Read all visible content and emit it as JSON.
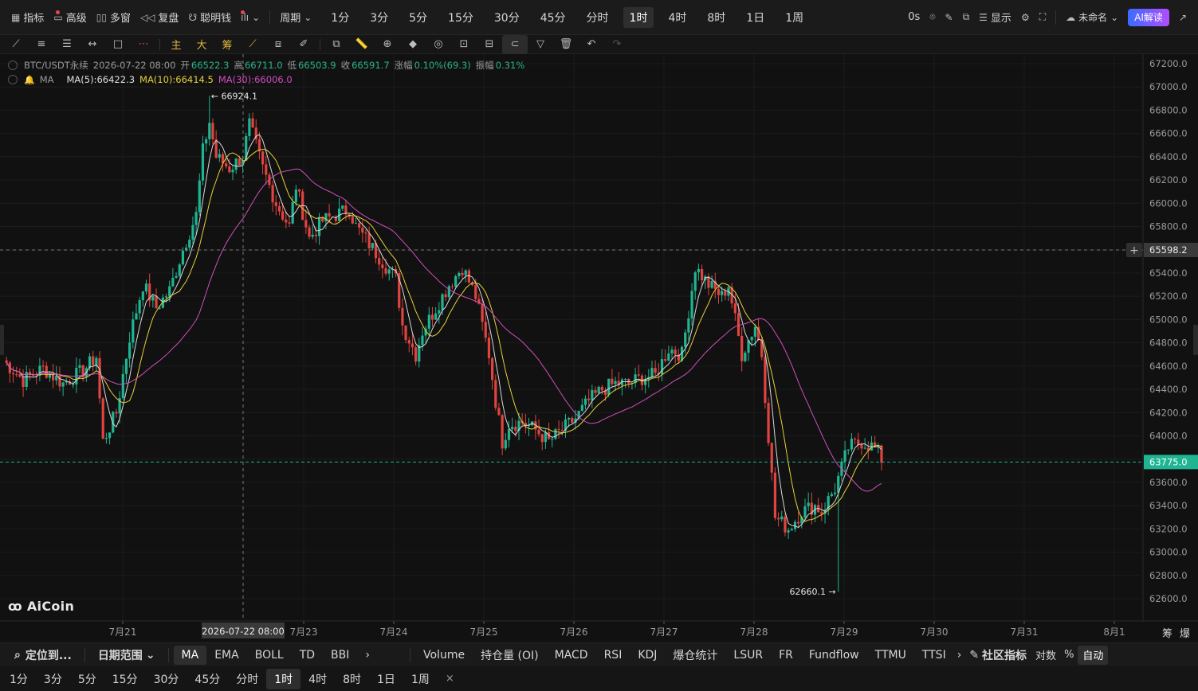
{
  "topbar": {
    "indicators": "指标",
    "advanced": "高级",
    "multi_window": "多窗",
    "replay": "复盘",
    "smart_money": "聪明钱",
    "period_dropdown": "周期",
    "periods": [
      "1分",
      "3分",
      "5分",
      "15分",
      "30分",
      "45分",
      "分时",
      "1时",
      "4时",
      "8时",
      "1日",
      "1周"
    ],
    "active_period": "1时",
    "countdown": "0s",
    "display": "显示",
    "layout_name": "未命名",
    "ai_button": "AI解读"
  },
  "drawbar": {
    "main": "主",
    "big": "大",
    "chip": "筹"
  },
  "legend": {
    "symbol": "BTC/USDT永续",
    "datetime": "2026-07-22 08:00",
    "open_label": "开",
    "open": "66522.3",
    "high_label": "高",
    "high": "66711.0",
    "low_label": "低",
    "low": "66503.9",
    "close_label": "收",
    "close": "66591.7",
    "change_label": "涨幅",
    "change": "0.10%(69.3)",
    "amp_label": "振幅",
    "amp": "0.31%",
    "ma_name": "MA",
    "ma5": "MA(5):66422.3",
    "ma10": "MA(10):66414.5",
    "ma30": "MA(30):66006.0"
  },
  "chart_data": {
    "type": "candlestick",
    "symbol": "BTC/USDT永续",
    "interval": "1时",
    "y_ticks": [
      "67200.0",
      "67000.0",
      "66800.0",
      "66600.0",
      "66400.0",
      "66200.0",
      "66000.0",
      "65800.0",
      "65600.0",
      "65400.0",
      "65200.0",
      "65000.0",
      "64800.0",
      "64600.0",
      "64400.0",
      "64200.0",
      "64000.0",
      "63800.0",
      "63600.0",
      "63400.0",
      "63200.0",
      "63000.0",
      "62800.0",
      "62600.0"
    ],
    "ylim": [
      62450,
      67300
    ],
    "x_ticks": [
      "7月21",
      "7月23",
      "7月24",
      "7月25",
      "7月26",
      "7月27",
      "7月28",
      "7月29",
      "7月30",
      "7月31",
      "8月1"
    ],
    "crosshair_x_label": "2026-07-22 08:00",
    "crosshair_price": "65598.2",
    "last_price": "63775.0",
    "high_marker": "66924.1",
    "low_marker": "62660.1",
    "close_path": [
      [
        0,
        64650
      ],
      [
        6,
        64480
      ],
      [
        12,
        64580
      ],
      [
        18,
        64450
      ],
      [
        24,
        64560
      ],
      [
        28,
        64680
      ],
      [
        30,
        63950
      ],
      [
        34,
        64200
      ],
      [
        38,
        64850
      ],
      [
        42,
        65300
      ],
      [
        46,
        65100
      ],
      [
        50,
        65250
      ],
      [
        54,
        65600
      ],
      [
        58,
        65900
      ],
      [
        60,
        66450
      ],
      [
        62,
        66700
      ],
      [
        64,
        66400
      ],
      [
        68,
        66300
      ],
      [
        72,
        66400
      ],
      [
        74,
        66680
      ],
      [
        78,
        66300
      ],
      [
        82,
        66000
      ],
      [
        86,
        65800
      ],
      [
        88,
        66150
      ],
      [
        92,
        65700
      ],
      [
        96,
        65850
      ],
      [
        100,
        65900
      ],
      [
        104,
        65950
      ],
      [
        106,
        65800
      ],
      [
        110,
        65650
      ],
      [
        114,
        65500
      ],
      [
        118,
        65350
      ],
      [
        120,
        64950
      ],
      [
        124,
        64700
      ],
      [
        126,
        64900
      ],
      [
        130,
        65100
      ],
      [
        134,
        65300
      ],
      [
        138,
        65450
      ],
      [
        142,
        65200
      ],
      [
        146,
        64700
      ],
      [
        148,
        64300
      ],
      [
        150,
        63950
      ],
      [
        152,
        64100
      ],
      [
        156,
        64120
      ],
      [
        160,
        64050
      ],
      [
        164,
        63950
      ],
      [
        168,
        64050
      ],
      [
        172,
        64150
      ],
      [
        176,
        64300
      ],
      [
        180,
        64400
      ],
      [
        184,
        64450
      ],
      [
        188,
        64450
      ],
      [
        192,
        64500
      ],
      [
        196,
        64520
      ],
      [
        200,
        64750
      ],
      [
        204,
        64700
      ],
      [
        208,
        65450
      ],
      [
        212,
        65300
      ],
      [
        216,
        65200
      ],
      [
        218,
        65300
      ],
      [
        222,
        64700
      ],
      [
        226,
        64950
      ],
      [
        228,
        64700
      ],
      [
        230,
        64000
      ],
      [
        232,
        63300
      ],
      [
        236,
        63200
      ],
      [
        240,
        63350
      ],
      [
        244,
        63400
      ],
      [
        246,
        63350
      ],
      [
        250,
        63550
      ],
      [
        254,
        63900
      ],
      [
        258,
        63950
      ],
      [
        262,
        63900
      ],
      [
        264,
        63800
      ]
    ],
    "ma_series": [
      {
        "name": "MA(5)",
        "color": "#d8d8d8"
      },
      {
        "name": "MA(10)",
        "color": "#e6d13a"
      },
      {
        "name": "MA(30)",
        "color": "#d14ec0"
      }
    ]
  },
  "indbar": {
    "locate": "定位到...",
    "date_range": "日期范围",
    "main_inds": [
      "MA",
      "EMA",
      "BOLL",
      "TD",
      "BBI"
    ],
    "active_main": "MA",
    "sub_inds": [
      "Volume",
      "持仓量 (OI)",
      "MACD",
      "RSI",
      "KDJ",
      "爆仓统计",
      "LSUR",
      "FR",
      "Fundflow",
      "TTMU",
      "TTSI"
    ],
    "community": "社区指标",
    "log": "对数",
    "pct": "%",
    "auto": "自动"
  },
  "perbar": {
    "periods": [
      "1分",
      "3分",
      "5分",
      "15分",
      "30分",
      "45分",
      "分时",
      "1时",
      "4时",
      "8时",
      "1日",
      "1周"
    ],
    "active": "1时",
    "close": "×"
  },
  "right_labels": {
    "chip": "筹",
    "liq": "爆"
  },
  "logo": "AiCoin"
}
